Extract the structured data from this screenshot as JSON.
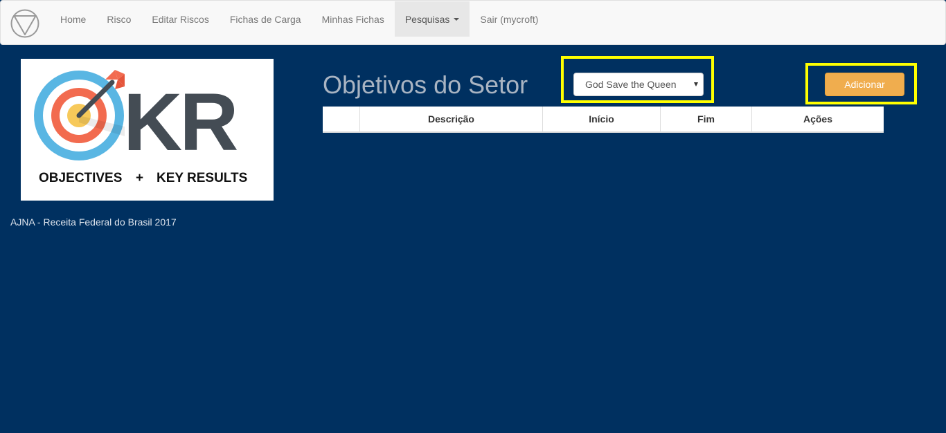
{
  "navbar": {
    "brand_icon": "circle-triangle-logo-icon",
    "items": [
      {
        "label": "Home"
      },
      {
        "label": "Risco"
      },
      {
        "label": "Editar Riscos"
      },
      {
        "label": "Fichas de Carga"
      },
      {
        "label": "Minhas Fichas"
      },
      {
        "label": "Pesquisas",
        "active": true,
        "dropdown": true
      },
      {
        "label": "Sair (mycroft)"
      }
    ]
  },
  "logo": {
    "big_text": "KR",
    "subtitle_left": "OBJECTIVES",
    "subtitle_plus": "+",
    "subtitle_right": "KEY RESULTS"
  },
  "footer": {
    "text": "AJNA - Receita Federal do Brasil 2017"
  },
  "main": {
    "title": "Objetivos do Setor",
    "setor_select": {
      "value": "God Save the Queen"
    },
    "add_button": "Adicionar",
    "table": {
      "headers": [
        "",
        "Descrição",
        "Início",
        "Fim",
        "Ações"
      ],
      "rows": []
    }
  },
  "colors": {
    "background": "#003060",
    "highlight": "#ffff00",
    "add_button": "#f0ad4e",
    "navbar": "#f8f8f8"
  }
}
